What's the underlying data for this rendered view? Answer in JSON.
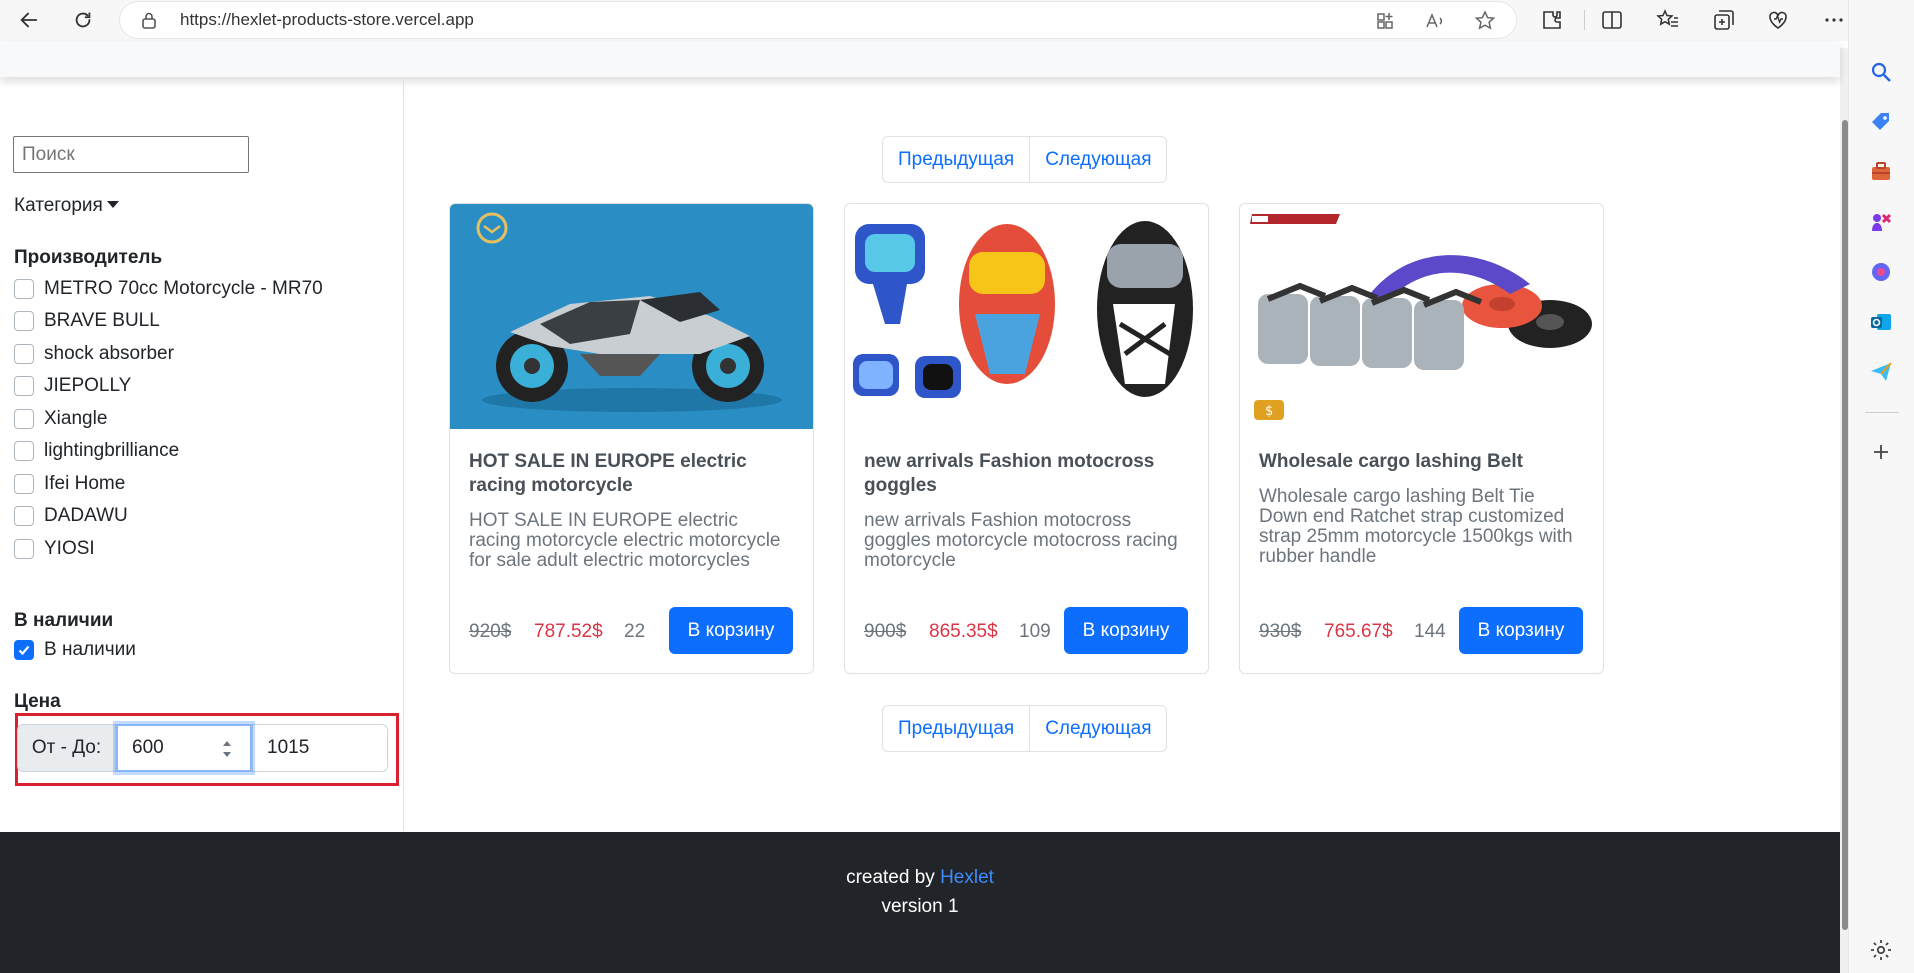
{
  "browser": {
    "url": "https://hexlet-products-store.vercel.app"
  },
  "filters": {
    "search_placeholder": "Поиск",
    "category_label": "Категория",
    "manufacturer_title": "Производитель",
    "manufacturers": [
      {
        "label": "METRO 70cc Motorcycle - MR70",
        "checked": false
      },
      {
        "label": "BRAVE BULL",
        "checked": false
      },
      {
        "label": "shock absorber",
        "checked": false
      },
      {
        "label": "JIEPOLLY",
        "checked": false
      },
      {
        "label": "Xiangle",
        "checked": false
      },
      {
        "label": "lightingbrilliance",
        "checked": false
      },
      {
        "label": "Ifei Home",
        "checked": false
      },
      {
        "label": "DADAWU",
        "checked": false
      },
      {
        "label": "YIOSI",
        "checked": false
      }
    ],
    "availability_title": "В наличии",
    "availability_label": "В наличии",
    "availability_checked": true,
    "price_title": "Цена",
    "price_range_label": "От - До:",
    "price_from": "600",
    "price_to": "1015"
  },
  "pagination": {
    "prev": "Предыдущая",
    "next": "Следующая"
  },
  "products": [
    {
      "title": "HOT SALE IN EUROPE electric racing motorcycle",
      "description": "HOT SALE IN EUROPE electric racing motorcycle electric motorcycle for sale adult electric motorcycles",
      "old_price": "920$",
      "price": "787.52$",
      "stock": "22",
      "button": "В корзину"
    },
    {
      "title": "new arrivals Fashion motocross goggles",
      "description": "new arrivals Fashion motocross goggles motorcycle motocross racing motorcycle",
      "old_price": "900$",
      "price": "865.35$",
      "stock": "109",
      "button": "В корзину"
    },
    {
      "title": "Wholesale cargo lashing Belt",
      "description": "Wholesale cargo lashing Belt Tie Down end Ratchet strap customized strap 25mm motorcycle 1500kgs with rubber handle",
      "old_price": "930$",
      "price": "765.67$",
      "stock": "144",
      "button": "В корзину"
    }
  ],
  "footer": {
    "created_by": "created by",
    "brand": "Hexlet",
    "version": "version 1"
  },
  "colors": {
    "primary": "#0d6efd",
    "sale_price": "#dc3545",
    "footer_bg": "#212529",
    "highlight_box": "#d9202f"
  }
}
